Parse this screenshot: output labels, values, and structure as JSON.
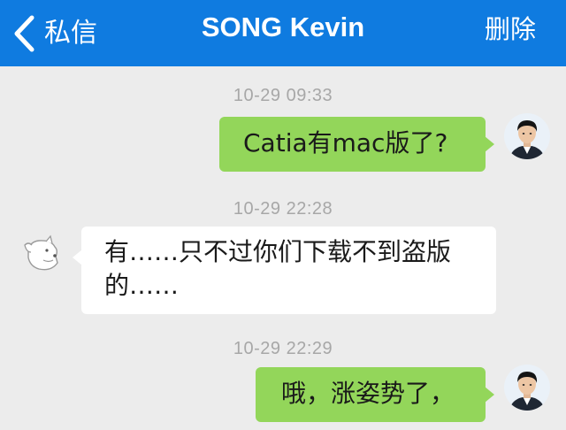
{
  "nav": {
    "back_label": "私信",
    "title": "SONG Kevin",
    "action_label": "删除",
    "accent_color": "#0f7be0"
  },
  "messages": [
    {
      "timestamp": "10-29 09:33",
      "direction": "outgoing",
      "text": "Catia有mac版了?"
    },
    {
      "timestamp": "10-29 22:28",
      "direction": "incoming",
      "line1": "有……只不过你们下载不到盗版",
      "line2": "的……"
    },
    {
      "timestamp": "10-29 22:29",
      "direction": "outgoing",
      "text": "哦，涨姿势了，"
    }
  ],
  "colors": {
    "outgoing_bubble": "#93d65a",
    "incoming_bubble": "#ffffff",
    "background": "#ececec",
    "timestamp": "#a7a7a7"
  },
  "icons": {
    "back": "chevron-left-icon",
    "self_avatar": "user-photo-avatar",
    "contact_avatar": "dog-doodle-avatar"
  }
}
